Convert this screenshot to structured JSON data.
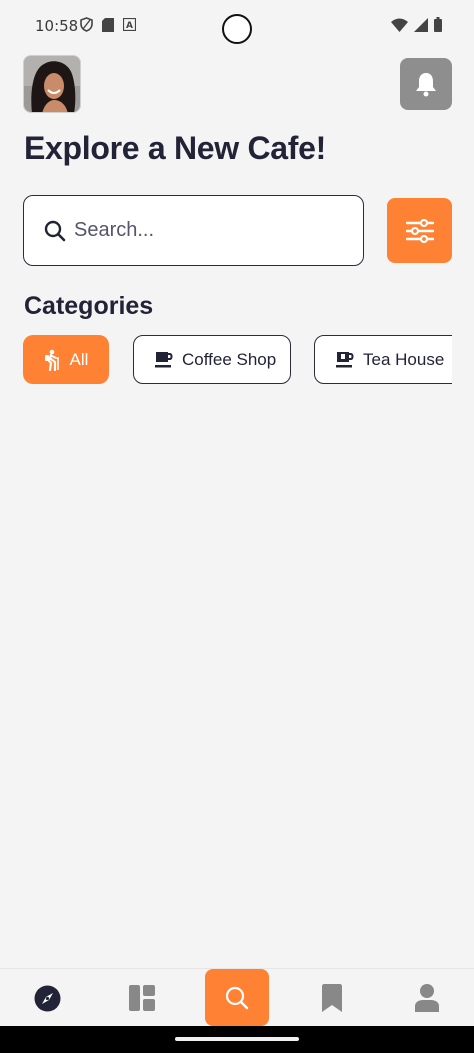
{
  "status_bar": {
    "time": "10:58"
  },
  "header": {
    "title": "Explore a New Cafe!"
  },
  "search": {
    "placeholder": "Search..."
  },
  "categories": {
    "title": "Categories",
    "items": [
      {
        "label": "All",
        "icon": "hiker-icon",
        "active": true
      },
      {
        "label": "Coffee Shop",
        "icon": "coffee-cup-icon",
        "active": false
      },
      {
        "label": "Tea House",
        "icon": "tea-cup-icon",
        "active": false
      }
    ]
  },
  "bottom_nav": {
    "items": [
      {
        "icon": "compass-icon",
        "active": false
      },
      {
        "icon": "dashboard-icon",
        "active": false
      },
      {
        "icon": "search-icon",
        "active": true
      },
      {
        "icon": "bookmark-icon",
        "active": false
      },
      {
        "icon": "profile-icon",
        "active": false
      }
    ]
  },
  "colors": {
    "accent": "#ff8133",
    "text_dark": "#232338",
    "background": "#f4f4f4",
    "bell_button_bg": "#8e8e8e"
  }
}
